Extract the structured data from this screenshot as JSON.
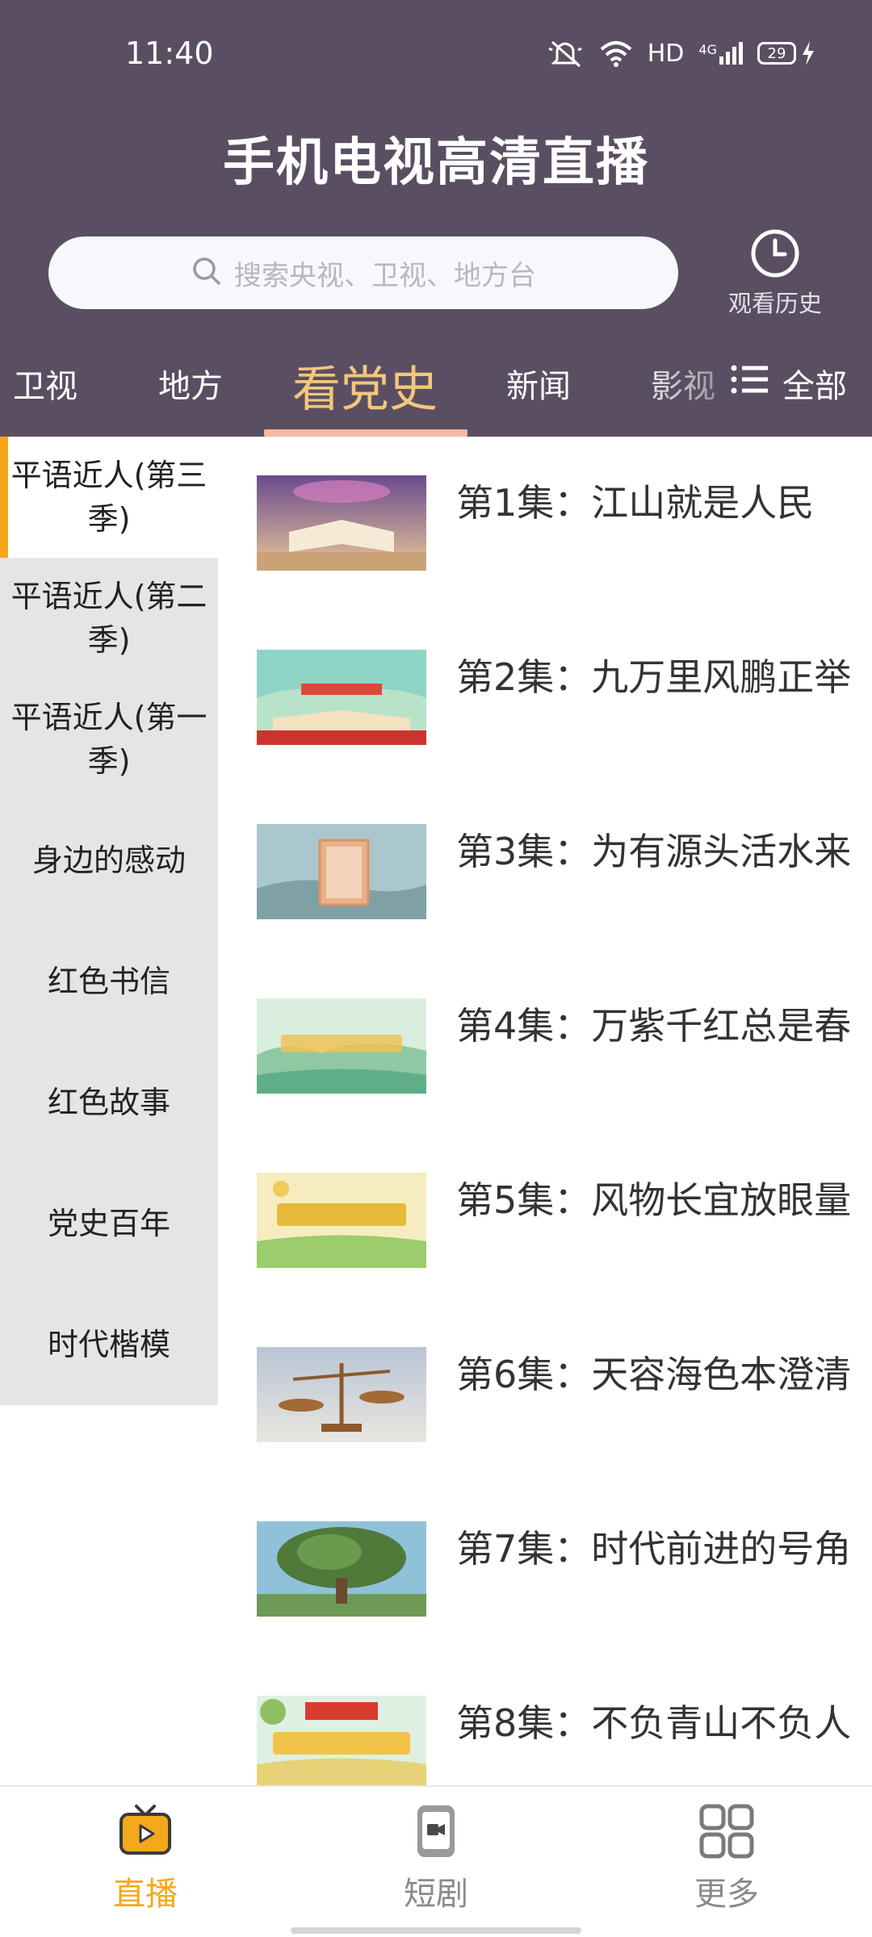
{
  "status_bar": {
    "time": "11:40",
    "network": "HD",
    "signal": "4G",
    "battery": "29"
  },
  "app": {
    "title": "手机电视高清直播"
  },
  "search": {
    "placeholder": "搜索央视、卫视、地方台"
  },
  "history": {
    "label": "观看历史"
  },
  "tabs": [
    {
      "label": "卫视"
    },
    {
      "label": "地方"
    },
    {
      "label": "看党史"
    },
    {
      "label": "新闻"
    },
    {
      "label": "影视"
    }
  ],
  "all_button": {
    "label": "全部"
  },
  "sidebar": {
    "items": [
      {
        "label": "平语近人(第三季)"
      },
      {
        "label": "平语近人(第二季)"
      },
      {
        "label": "平语近人(第一季)"
      },
      {
        "label": "身边的感动"
      },
      {
        "label": "红色书信"
      },
      {
        "label": "红色故事"
      },
      {
        "label": "党史百年"
      },
      {
        "label": "时代楷模"
      }
    ]
  },
  "episodes": [
    {
      "title": "第1集：江山就是人民"
    },
    {
      "title": "第2集：九万里风鹏正举"
    },
    {
      "title": "第3集：为有源头活水来"
    },
    {
      "title": "第4集：万紫千红总是春"
    },
    {
      "title": "第5集：风物长宜放眼量"
    },
    {
      "title": "第6集：天容海色本澄清"
    },
    {
      "title": "第7集：时代前进的号角"
    },
    {
      "title": "第8集：不负青山不负人"
    }
  ],
  "bottom_nav": {
    "items": [
      {
        "label": "直播"
      },
      {
        "label": "短剧"
      },
      {
        "label": "更多"
      }
    ]
  },
  "colors": {
    "header_bg": "#5a4f62",
    "active_tab": "#f4c67c",
    "tab_underline": "#f6b9a3",
    "sidebar_accent": "#f7a61b",
    "nav_active": "#f5a81c",
    "nav_inactive": "#8a8a8a"
  }
}
